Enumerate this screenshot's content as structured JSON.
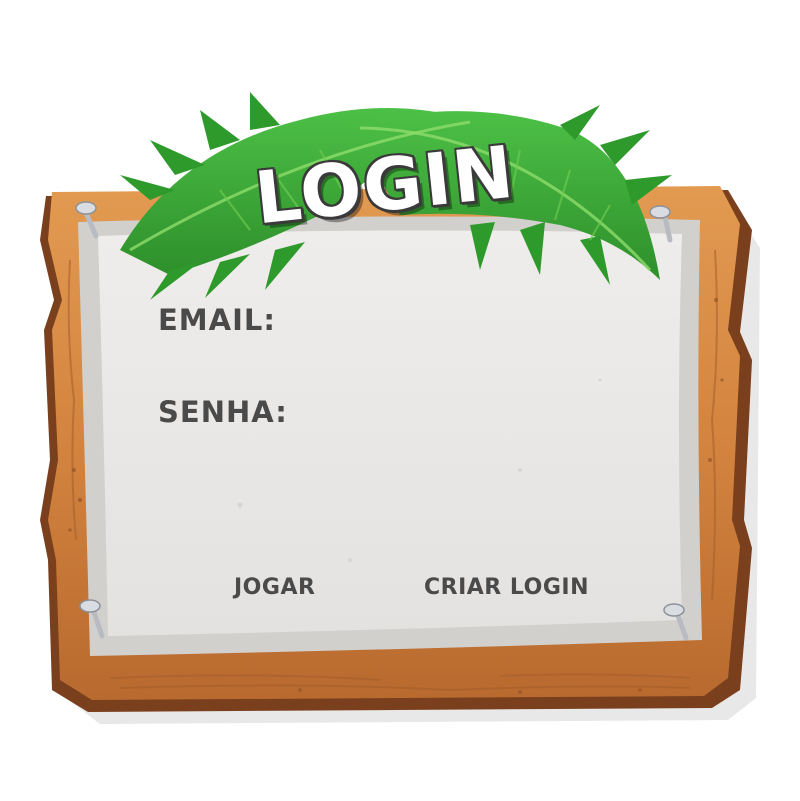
{
  "board": {
    "title": "LOGIN"
  },
  "form": {
    "email_label": "EMAIL:",
    "email_value": "",
    "password_label": "SENHA:",
    "password_value": ""
  },
  "actions": {
    "play_label": "JOGAR",
    "create_login_label": "CRIAR LOGIN"
  },
  "colors": {
    "wood_light": "#d88a43",
    "wood_dark": "#7a3f1d",
    "paper": "#e9e7e6",
    "paper_border": "#d2d0cd",
    "leaf_green": "#3fae3a",
    "text_dark": "#4a4a4a"
  },
  "icons": [
    "palm-leaf-icon",
    "nail-icon"
  ]
}
